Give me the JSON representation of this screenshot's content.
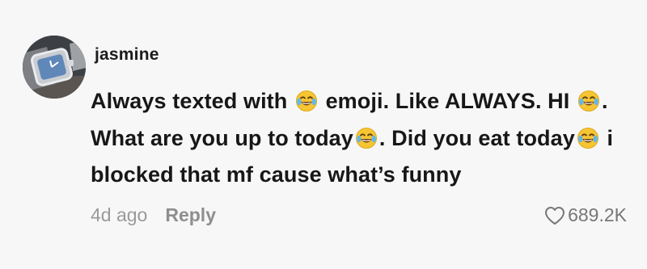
{
  "comment": {
    "author": "jasmine",
    "text_segments": [
      {
        "text": "Always texted with "
      },
      {
        "emoji": "face-with-tears-of-joy-icon"
      },
      {
        "text": " emoji. Like ALWAYS. HI "
      },
      {
        "emoji": "face-with-tears-of-joy-icon"
      },
      {
        "text": ". What are you up to today"
      },
      {
        "emoji": "face-with-tears-of-joy-icon"
      },
      {
        "text": ". Did you eat today"
      },
      {
        "emoji": "face-with-tears-of-joy-icon"
      },
      {
        "text": " i blocked that mf cause what’s funny"
      }
    ],
    "timestamp": "4d ago",
    "reply_label": "Reply",
    "like_count": "689.2K"
  },
  "colors": {
    "background": "#f7f7f7",
    "text": "#171717",
    "muted": "#9a9a9a",
    "emoji_face": "#f6c532"
  },
  "icons": {
    "avatar": "avatar-wristwatch-photo",
    "like": "heart-outline-icon"
  }
}
